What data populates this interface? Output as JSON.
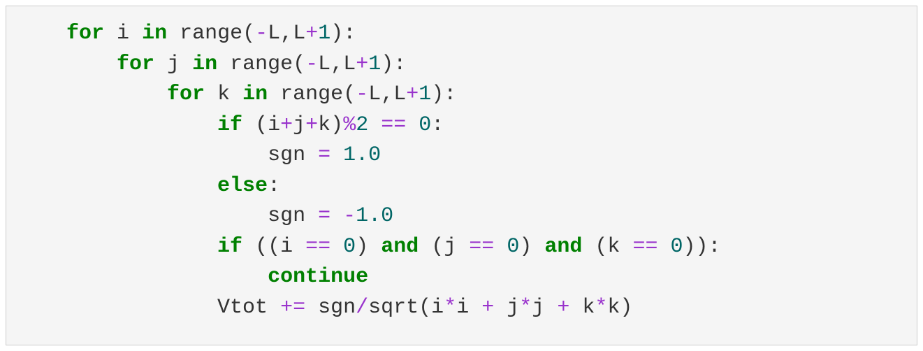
{
  "code": {
    "tokens": {
      "for": "for",
      "in": "in",
      "range": "range",
      "if": "if",
      "else": "else",
      "and": "and",
      "continue": "continue",
      "i": "i",
      "j": "j",
      "k": "k",
      "L": "L",
      "sgn": "sgn",
      "Vtot": "Vtot",
      "sqrt": "sqrt",
      "lparen": "(",
      "rparen": ")",
      "comma": ",",
      "colon": ":",
      "minus": "-",
      "plus": "+",
      "plus_eq": "+=",
      "assign": "=",
      "eq": "==",
      "mod": "%",
      "star": "*",
      "slash": "/",
      "n0": "0",
      "n1": "1",
      "n2": "2",
      "f1_0": "1.0",
      "fneg1_0": "1.0"
    },
    "indent": {
      "lvl1": "    ",
      "lvl2": "        ",
      "lvl3": "            ",
      "lvl4": "                ",
      "lvl5": "                    "
    }
  }
}
